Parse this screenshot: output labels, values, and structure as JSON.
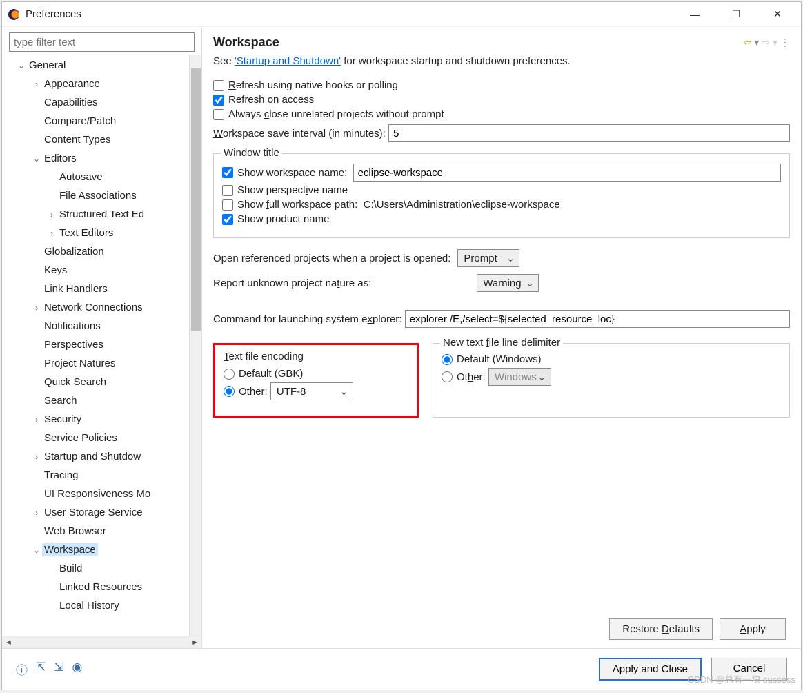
{
  "window": {
    "title": "Preferences"
  },
  "filter": {
    "placeholder": "type filter text"
  },
  "tree": [
    {
      "label": "General",
      "depth": 0,
      "arrow": "v"
    },
    {
      "label": "Appearance",
      "depth": 1,
      "arrow": ">"
    },
    {
      "label": "Capabilities",
      "depth": 1,
      "arrow": ""
    },
    {
      "label": "Compare/Patch",
      "depth": 1,
      "arrow": ""
    },
    {
      "label": "Content Types",
      "depth": 1,
      "arrow": ""
    },
    {
      "label": "Editors",
      "depth": 1,
      "arrow": "v"
    },
    {
      "label": "Autosave",
      "depth": 2,
      "arrow": ""
    },
    {
      "label": "File Associations",
      "depth": 2,
      "arrow": ""
    },
    {
      "label": "Structured Text Ed",
      "depth": 2,
      "arrow": ">"
    },
    {
      "label": "Text Editors",
      "depth": 2,
      "arrow": ">"
    },
    {
      "label": "Globalization",
      "depth": 1,
      "arrow": ""
    },
    {
      "label": "Keys",
      "depth": 1,
      "arrow": ""
    },
    {
      "label": "Link Handlers",
      "depth": 1,
      "arrow": ""
    },
    {
      "label": "Network Connections",
      "depth": 1,
      "arrow": ">"
    },
    {
      "label": "Notifications",
      "depth": 1,
      "arrow": ""
    },
    {
      "label": "Perspectives",
      "depth": 1,
      "arrow": ""
    },
    {
      "label": "Project Natures",
      "depth": 1,
      "arrow": ""
    },
    {
      "label": "Quick Search",
      "depth": 1,
      "arrow": ""
    },
    {
      "label": "Search",
      "depth": 1,
      "arrow": ""
    },
    {
      "label": "Security",
      "depth": 1,
      "arrow": ">"
    },
    {
      "label": "Service Policies",
      "depth": 1,
      "arrow": ""
    },
    {
      "label": "Startup and Shutdow",
      "depth": 1,
      "arrow": ">"
    },
    {
      "label": "Tracing",
      "depth": 1,
      "arrow": ""
    },
    {
      "label": "UI Responsiveness Mo",
      "depth": 1,
      "arrow": ""
    },
    {
      "label": "User Storage Service",
      "depth": 1,
      "arrow": ">"
    },
    {
      "label": "Web Browser",
      "depth": 1,
      "arrow": ""
    },
    {
      "label": "Workspace",
      "depth": 1,
      "arrow": "v",
      "selected": true
    },
    {
      "label": "Build",
      "depth": 2,
      "arrow": ""
    },
    {
      "label": "Linked Resources",
      "depth": 2,
      "arrow": ""
    },
    {
      "label": "Local History",
      "depth": 2,
      "arrow": ""
    }
  ],
  "main": {
    "title": "Workspace",
    "intro_pre": "See ",
    "intro_link": "'Startup and Shutdown'",
    "intro_post": " for workspace startup and shutdown preferences.",
    "refresh_native": "Refresh using native hooks or polling",
    "refresh_access": "Refresh on access",
    "always_close": "Always close unrelated projects without prompt",
    "save_interval_label": "Workspace save interval (in minutes):",
    "save_interval_value": "5",
    "window_title_legend": "Window title",
    "show_workspace_name": "Show workspace name:",
    "workspace_name_value": "eclipse-workspace",
    "show_perspective": "Show perspective name",
    "show_full_path": "Show full workspace path:",
    "full_path_value": "C:\\Users\\Administration\\eclipse-workspace",
    "show_product": "Show product name",
    "open_ref_label": "Open referenced projects when a project is opened:",
    "open_ref_value": "Prompt",
    "report_nature_label": "Report unknown project nature as:",
    "report_nature_value": "Warning",
    "explorer_label": "Command for launching system explorer:",
    "explorer_value": "explorer /E,/select=${selected_resource_loc}",
    "encoding_legend": "Text file encoding",
    "encoding_default": "Default (GBK)",
    "encoding_other": "Other:",
    "encoding_value": "UTF-8",
    "delimiter_legend": "New text file line delimiter",
    "delimiter_default": "Default (Windows)",
    "delimiter_other": "Other:",
    "delimiter_value": "Windows",
    "restore_defaults": "Restore Defaults",
    "apply": "Apply"
  },
  "footer": {
    "apply_close": "Apply and Close",
    "cancel": "Cancel"
  },
  "watermark": "CSDN @总有一块 success"
}
